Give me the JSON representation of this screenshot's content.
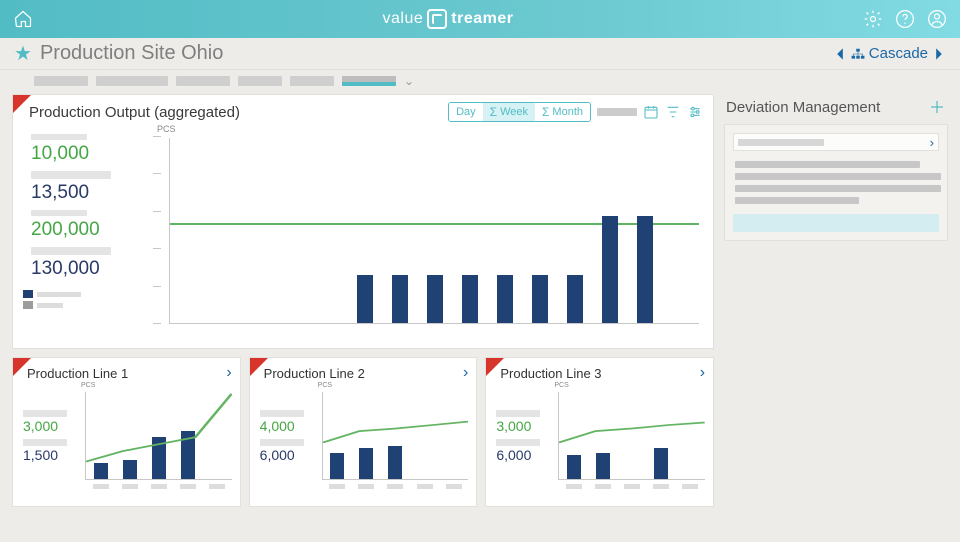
{
  "app": {
    "brand_left": "value",
    "brand_right": "treamer"
  },
  "breadcrumb": {
    "title": "Production Site Ohio"
  },
  "cascade": {
    "label": "Cascade"
  },
  "main_card": {
    "title": "Production Output (aggregated)",
    "ylabel": "PCS",
    "timerange": {
      "day": "Day",
      "week": "Week",
      "month": "Month",
      "selected": "week"
    },
    "stats": [
      {
        "value": "10,000",
        "color": "green"
      },
      {
        "value": "13,500",
        "color": "blue"
      },
      {
        "value": "200,000",
        "color": "green"
      },
      {
        "value": "130,000",
        "color": "blue"
      }
    ]
  },
  "chart_data": {
    "type": "bar",
    "title": "Production Output (aggregated)",
    "ylabel": "PCS",
    "ylim": [
      0,
      100
    ],
    "target_line": 53,
    "series": [
      {
        "name": "output",
        "values": [
          0,
          0,
          0,
          0,
          0,
          26,
          26,
          26,
          26,
          26,
          26,
          26,
          58,
          58,
          0
        ]
      }
    ]
  },
  "small_cards": [
    {
      "title": "Production Line 1",
      "ylabel": "PCS",
      "stats": [
        {
          "value": "3,000",
          "color": "green"
        },
        {
          "value": "1,500",
          "color": "blue"
        }
      ],
      "chart": {
        "type": "bar_line",
        "bars": [
          18,
          22,
          48,
          55,
          0
        ],
        "line": [
          20,
          32,
          40,
          48,
          98
        ],
        "ylim": [
          0,
          100
        ]
      }
    },
    {
      "title": "Production Line 2",
      "ylabel": "PCS",
      "stats": [
        {
          "value": "4,000",
          "color": "green"
        },
        {
          "value": "6,000",
          "color": "blue"
        }
      ],
      "chart": {
        "type": "bar_line",
        "bars": [
          30,
          36,
          38,
          0,
          0
        ],
        "line": [
          42,
          55,
          58,
          62,
          66
        ],
        "ylim": [
          0,
          100
        ]
      }
    },
    {
      "title": "Production Line 3",
      "ylabel": "PCS",
      "stats": [
        {
          "value": "3,000",
          "color": "green"
        },
        {
          "value": "6,000",
          "color": "blue"
        }
      ],
      "chart": {
        "type": "bar_line",
        "bars": [
          28,
          30,
          0,
          36,
          0
        ],
        "line": [
          42,
          55,
          58,
          62,
          65
        ],
        "ylim": [
          0,
          100
        ]
      }
    }
  ],
  "deviation": {
    "title": "Deviation Management"
  }
}
